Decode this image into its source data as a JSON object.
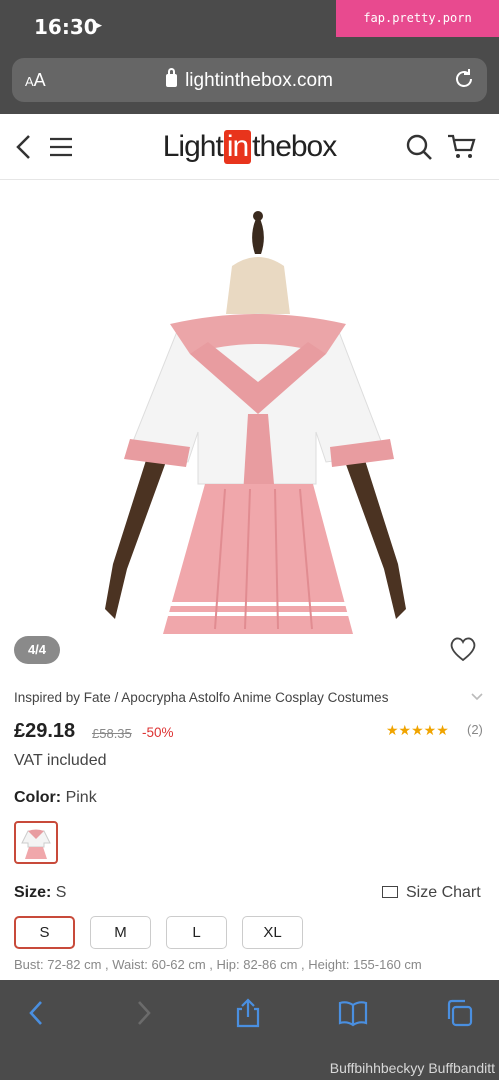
{
  "status_bar": {
    "time": "16:30",
    "tag": "fap.pretty.porn"
  },
  "browser": {
    "text_size_label_small": "A",
    "text_size_label_large": "A",
    "url": "lightinthebox.com"
  },
  "site": {
    "logo_left": "Light",
    "logo_mid": "in",
    "logo_right": "thebox"
  },
  "gallery": {
    "counter": "4/4"
  },
  "product": {
    "title": "Inspired by Fate / Apocrypha Astolfo Anime Cosplay Costumes",
    "price": "£29.18",
    "old_price": "£58.35",
    "discount": "-50%",
    "rating_stars": 5,
    "stars_text": "★★★★★",
    "review_count": "(2)",
    "vat": "VAT included",
    "color_label": "Color:",
    "color_value": "Pink",
    "size_label": "Size:",
    "size_value": "S",
    "size_chart": "Size Chart",
    "sizes": [
      "S",
      "M",
      "L",
      "XL"
    ],
    "selected_size": "S",
    "measurements": "Bust: 72-82 cm , Waist: 60-62 cm , Hip: 82-86 cm , Height: 155-160 cm"
  },
  "watermark": "Buffbihhbeckyy Buffbanditt",
  "colors": {
    "accent": "#c84a3a",
    "logo_red": "#e8341c",
    "star": "#f0a400",
    "toolbar_blue": "#4a8fe0"
  }
}
